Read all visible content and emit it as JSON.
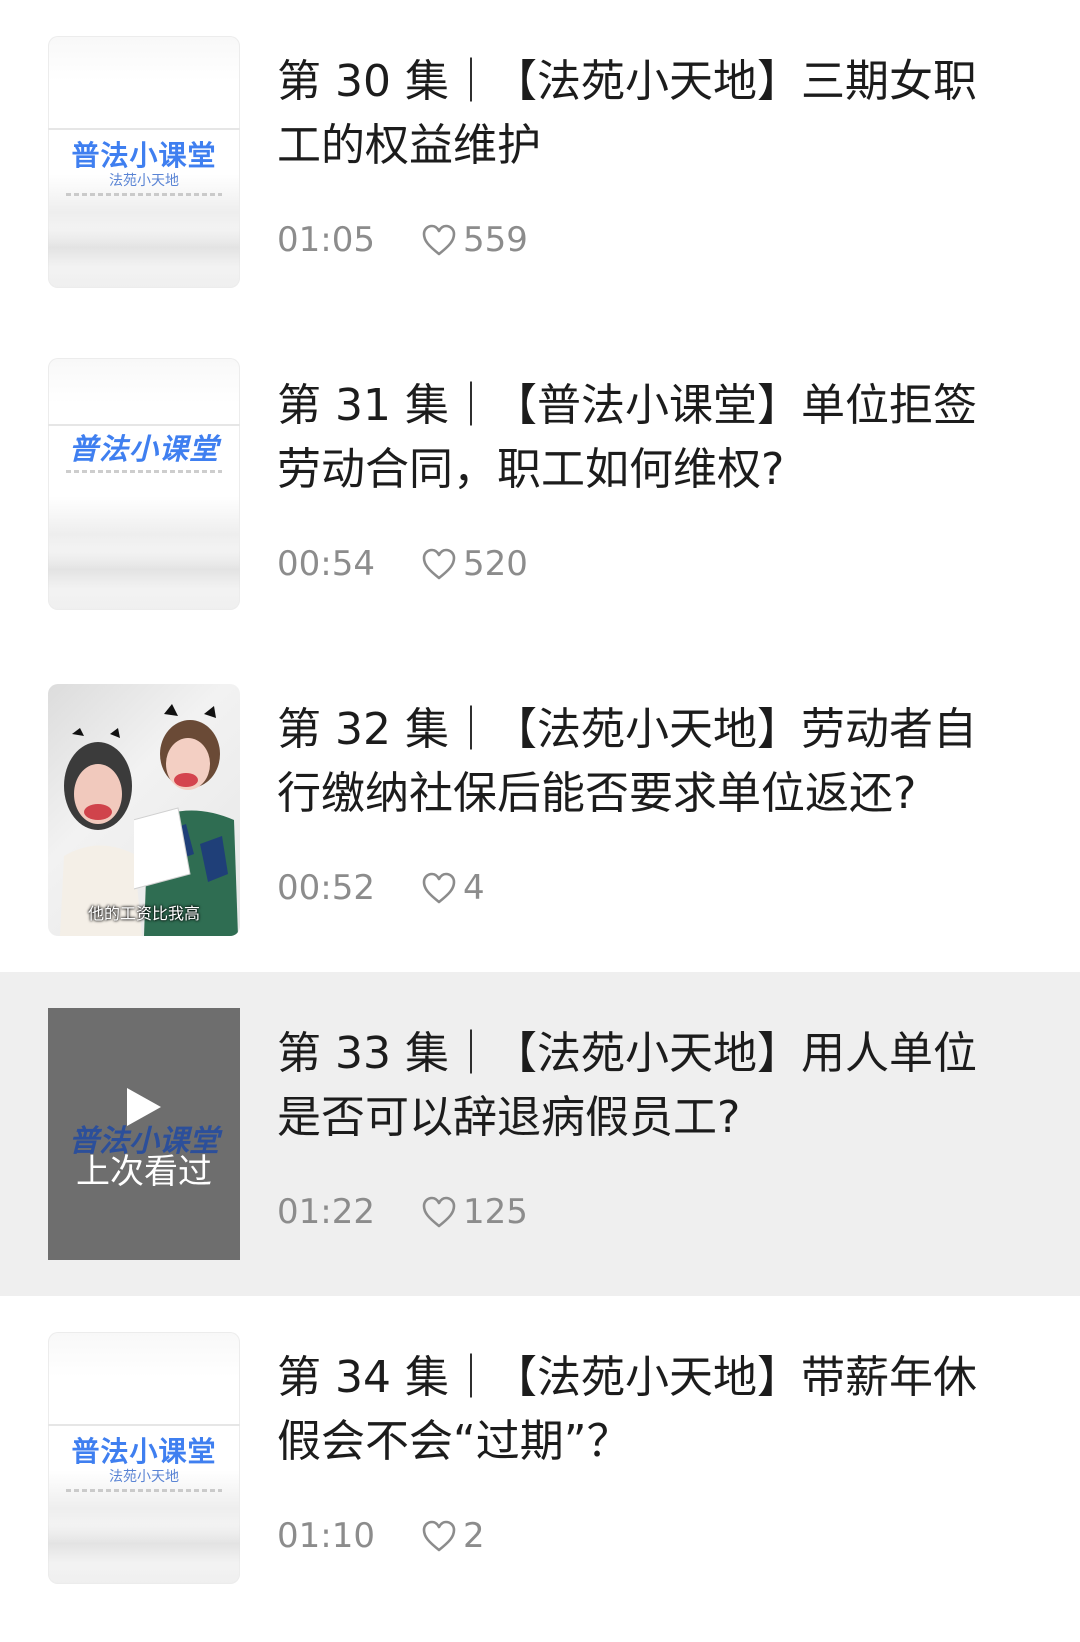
{
  "episodes": [
    {
      "title": "第 30 集｜【法苑小天地】三期女职工的权益维护",
      "duration": "01:05",
      "likes": "559",
      "thumbnail": {
        "type": "cover",
        "title": "普法小课堂",
        "subtitle": "法苑小天地"
      }
    },
    {
      "title": "第 31 集｜【普法小课堂】单位拒签劳动合同，职工如何维权?",
      "duration": "00:54",
      "likes": "520",
      "thumbnail": {
        "type": "cover",
        "title": "普法小课堂"
      }
    },
    {
      "title": "第 32 集｜【法苑小天地】劳动者自行缴纳社保后能否要求单位返还?",
      "duration": "00:52",
      "likes": "4",
      "thumbnail": {
        "type": "photo",
        "caption": "他的工资比我高"
      }
    },
    {
      "title": "第 33 集｜【法苑小天地】用人单位是否可以辞退病假员工?",
      "duration": "01:22",
      "likes": "125",
      "thumbnail": {
        "type": "last-watched",
        "title": "普法小课堂",
        "label": "上次看过"
      },
      "active": true
    },
    {
      "title": "第 34 集｜【法苑小天地】带薪年休假会不会“过期”？",
      "duration": "01:10",
      "likes": "2",
      "thumbnail": {
        "type": "cover",
        "title": "普法小课堂",
        "subtitle": "法苑小天地"
      }
    }
  ],
  "icons": {
    "likes": "heart-outline-icon",
    "play": "play-icon"
  },
  "colors": {
    "cover_title": "#3f7ff0",
    "active_row_bg": "#efefef",
    "meta_text": "#8c8c8c"
  }
}
